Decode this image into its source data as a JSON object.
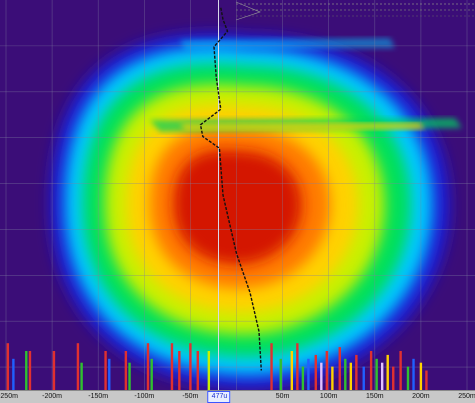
{
  "chart_data": {
    "type": "heatmap",
    "title": "",
    "xlabel": "",
    "ylabel": "",
    "x_unit": "m",
    "xlim": [
      -250,
      250
    ],
    "x_ticks": [
      "-250m",
      "-200m",
      "-150m",
      "-100m",
      "-50m",
      "0",
      "50m",
      "100m",
      "150m",
      "200m",
      "250m"
    ],
    "x_tick_values": [
      -250,
      -200,
      -150,
      -100,
      -50,
      0,
      50,
      100,
      150,
      200,
      250
    ],
    "cursor": {
      "x": 0,
      "label": " 477u"
    },
    "grid": true,
    "background_color": "#3b0d78",
    "colormap": [
      "#1b1bd6",
      "#00c8ff",
      "#00e05a",
      "#c8f000",
      "#ffd200",
      "#ff7a00",
      "#d41400"
    ],
    "depth_profile": [
      {
        "x": 0.5,
        "y": 0.02
      },
      {
        "x": 1.0,
        "y": 0.05
      },
      {
        "x": 2.0,
        "y": 0.08
      },
      {
        "x": -1.0,
        "y": 0.12
      },
      {
        "x": -0.5,
        "y": 0.2
      },
      {
        "x": 0.5,
        "y": 0.28
      },
      {
        "x": -4.0,
        "y": 0.32
      },
      {
        "x": -3.5,
        "y": 0.35
      },
      {
        "x": 0.2,
        "y": 0.38
      },
      {
        "x": 1.0,
        "y": 0.5
      },
      {
        "x": 4.0,
        "y": 0.65
      },
      {
        "x": 7.0,
        "y": 0.75
      },
      {
        "x": 9.0,
        "y": 0.85
      },
      {
        "x": 9.5,
        "y": 0.95
      }
    ],
    "spikes": [
      {
        "x": -248,
        "height": 0.12,
        "color": "#e03030"
      },
      {
        "x": -242,
        "height": 0.08,
        "color": "#2060ff"
      },
      {
        "x": -228,
        "height": 0.1,
        "color": "#30c030"
      },
      {
        "x": -224,
        "height": 0.1,
        "color": "#e03030"
      },
      {
        "x": -198,
        "height": 0.1,
        "color": "#e03030"
      },
      {
        "x": -172,
        "height": 0.12,
        "color": "#e03030"
      },
      {
        "x": -168,
        "height": 0.07,
        "color": "#30c030"
      },
      {
        "x": -142,
        "height": 0.1,
        "color": "#e03030"
      },
      {
        "x": -138,
        "height": 0.08,
        "color": "#2060ff"
      },
      {
        "x": -120,
        "height": 0.1,
        "color": "#e03030"
      },
      {
        "x": -116,
        "height": 0.07,
        "color": "#30c030"
      },
      {
        "x": -96,
        "height": 0.12,
        "color": "#e03030"
      },
      {
        "x": -92,
        "height": 0.08,
        "color": "#30c030"
      },
      {
        "x": -70,
        "height": 0.12,
        "color": "#e03030"
      },
      {
        "x": -62,
        "height": 0.1,
        "color": "#e03030"
      },
      {
        "x": -50,
        "height": 0.12,
        "color": "#e03030"
      },
      {
        "x": -42,
        "height": 0.1,
        "color": "#e03030"
      },
      {
        "x": -30,
        "height": 0.1,
        "color": "#c8f000"
      },
      {
        "x": 38,
        "height": 0.12,
        "color": "#e03030"
      },
      {
        "x": 48,
        "height": 0.08,
        "color": "#30c030"
      },
      {
        "x": 60,
        "height": 0.1,
        "color": "#ffd200"
      },
      {
        "x": 66,
        "height": 0.12,
        "color": "#e03030"
      },
      {
        "x": 72,
        "height": 0.06,
        "color": "#30c030"
      },
      {
        "x": 78,
        "height": 0.08,
        "color": "#2060ff"
      },
      {
        "x": 86,
        "height": 0.09,
        "color": "#e03030"
      },
      {
        "x": 92,
        "height": 0.07,
        "color": "#e0c0ff"
      },
      {
        "x": 98,
        "height": 0.1,
        "color": "#e03030"
      },
      {
        "x": 104,
        "height": 0.06,
        "color": "#ffd200"
      },
      {
        "x": 112,
        "height": 0.11,
        "color": "#e03030"
      },
      {
        "x": 118,
        "height": 0.08,
        "color": "#30c030"
      },
      {
        "x": 124,
        "height": 0.07,
        "color": "#ffd200"
      },
      {
        "x": 130,
        "height": 0.09,
        "color": "#e03030"
      },
      {
        "x": 138,
        "height": 0.06,
        "color": "#2060ff"
      },
      {
        "x": 146,
        "height": 0.1,
        "color": "#e03030"
      },
      {
        "x": 152,
        "height": 0.08,
        "color": "#30c030"
      },
      {
        "x": 158,
        "height": 0.07,
        "color": "#e0c0ff"
      },
      {
        "x": 164,
        "height": 0.09,
        "color": "#ffd200"
      },
      {
        "x": 170,
        "height": 0.06,
        "color": "#e03030"
      },
      {
        "x": 178,
        "height": 0.1,
        "color": "#e03030"
      },
      {
        "x": 186,
        "height": 0.06,
        "color": "#30c030"
      },
      {
        "x": 192,
        "height": 0.08,
        "color": "#2060ff"
      },
      {
        "x": 200,
        "height": 0.07,
        "color": "#ffd200"
      },
      {
        "x": 206,
        "height": 0.05,
        "color": "#e03030"
      }
    ]
  }
}
